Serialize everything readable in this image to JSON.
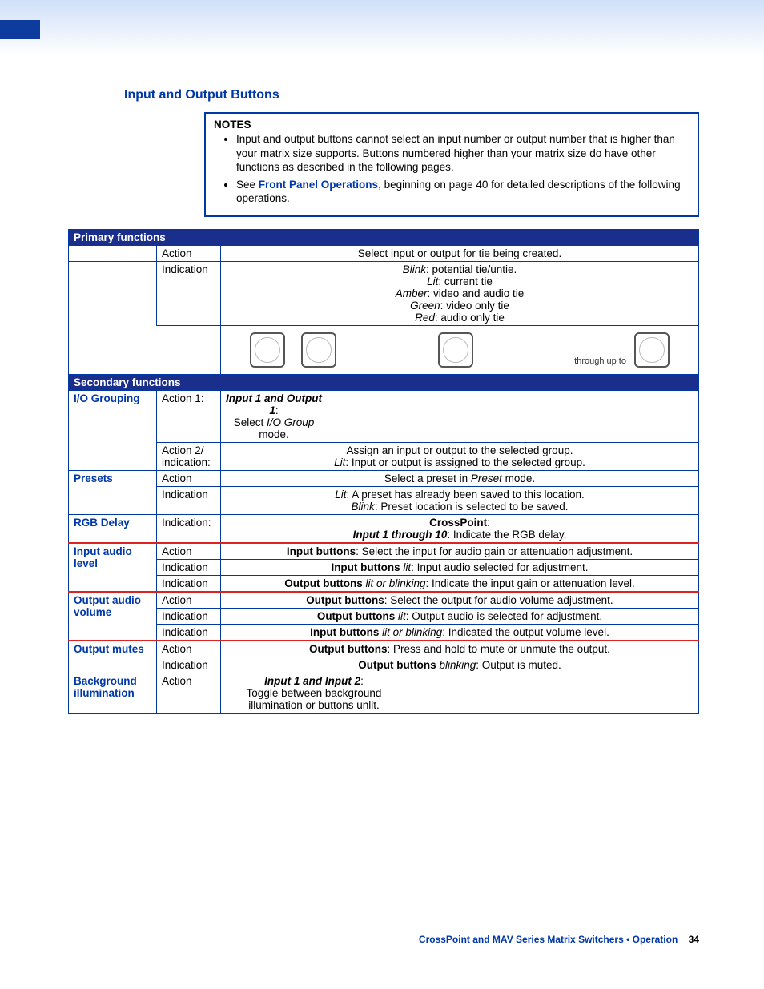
{
  "heading": "Input and Output Buttons",
  "notes": {
    "title": "NOTES",
    "items": [
      {
        "pre": "Input and output buttons cannot select an input number or output number that is higher than your matrix size supports. Buttons numbered higher than your matrix size do have other functions as described in the following pages."
      },
      {
        "pre": "See ",
        "link": "Front Panel Operations",
        "post": ", beginning on page 40 for detailed descriptions of the following operations."
      }
    ]
  },
  "primary_header": "Primary functions",
  "secondary_header": "Secondary functions",
  "primary": {
    "action_label": "Action",
    "action_text": "Select input or output for tie being created.",
    "indication_label": "Indication",
    "ind_lines": [
      {
        "em": "Blink",
        "rest": ": potential tie/untie."
      },
      {
        "em": "Lit",
        "rest": ": current tie"
      },
      {
        "em": "Amber",
        "rest": ": video and audio tie"
      },
      {
        "em": "Green",
        "rest": ": video only tie"
      },
      {
        "em": "Red",
        "rest": ": audio only tie"
      }
    ],
    "through": "through up to"
  },
  "secondary": {
    "io_grouping": {
      "label": "I/O Grouping",
      "a1_label": "Action 1:",
      "a1_title": "Input 1 and Output 1",
      "a1_colon": ":",
      "a1_l1a": "Select ",
      "a1_l1b": "I/O Group",
      "a1_l1c": " mode.",
      "a2_label": "Action 2/ indication:",
      "a2_l1": "Assign an input or output to the selected group.",
      "a2_l2em": "Lit",
      "a2_l2rest": ": Input or output is assigned to the selected group."
    },
    "presets": {
      "label": "Presets",
      "action_label": "Action",
      "action_pre": "Select a preset in ",
      "action_em": "Preset",
      "action_post": " mode.",
      "ind_label": "Indication",
      "ind_l1em": "Lit",
      "ind_l1rest": ": A preset has already been saved to this location.",
      "ind_l2em": "Blink",
      "ind_l2rest": ": Preset location is selected to be saved."
    },
    "rgb": {
      "label": "RGB Delay",
      "ind_label": "Indication:",
      "title": "CrossPoint",
      "title_colon": ":",
      "line_bold": "Input 1 through 10",
      "line_rest": ": Indicate the RGB delay."
    },
    "input_audio": {
      "label": "Input audio level",
      "action_label": "Action",
      "action_bold": "Input buttons",
      "action_rest": ": Select the input for audio gain or attenuation adjustment.",
      "ind1_label": "Indication",
      "ind1_bold": "Input buttons",
      "ind1_em": " lit",
      "ind1_rest": ": Input audio selected for adjustment.",
      "ind2_label": "Indication",
      "ind2_bold": "Output buttons",
      "ind2_em": " lit or blinking",
      "ind2_rest": ": Indicate the input gain or attenuation level."
    },
    "output_volume": {
      "label": "Output audio volume",
      "action_label": "Action",
      "action_bold": "Output buttons",
      "action_rest": ": Select the output for audio volume adjustment.",
      "ind1_label": "Indication",
      "ind1_bold": "Output buttons",
      "ind1_em": " lit",
      "ind1_rest": ": Output audio is selected for adjustment.",
      "ind2_label": "Indication",
      "ind2_bold": "Input buttons",
      "ind2_em": " lit or blinking",
      "ind2_rest": ": Indicated the output volume level."
    },
    "output_mutes": {
      "label": "Output mutes",
      "action_label": "Action",
      "action_bold": "Output buttons",
      "action_rest": ": Press and hold to mute or unmute the output.",
      "ind_label": "Indication",
      "ind_bold": "Output buttons",
      "ind_em": " blinking",
      "ind_rest": ": Output is muted."
    },
    "background": {
      "label": "Background illumination",
      "action_label": "Action",
      "title": "Input 1 and Input 2",
      "title_colon": ":",
      "line": "Toggle between between background illumination or buttons unlit."
    }
  },
  "background_line_fixed": "Toggle between background illumination or buttons unlit.",
  "footer": {
    "text": "CrossPoint and MAV Series Matrix Switchers • Operation",
    "page": "34"
  }
}
